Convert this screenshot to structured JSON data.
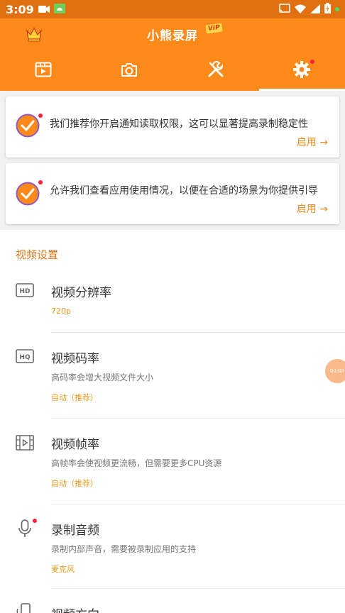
{
  "status_bar": {
    "time": "3:09"
  },
  "header": {
    "title": "小熊录屏",
    "vip": "VIP"
  },
  "tabs": [
    {
      "name": "videos",
      "icon": "film-icon"
    },
    {
      "name": "screenshots",
      "icon": "camera-icon"
    },
    {
      "name": "tools",
      "icon": "tools-icon"
    },
    {
      "name": "settings",
      "icon": "gear-icon",
      "active": true
    }
  ],
  "cards": [
    {
      "text": "我们推荐你开启通知读取权限，这可以显著提高录制稳定性",
      "action": "启用 →"
    },
    {
      "text": "允许我们查看应用使用情况，以便在合适的场景为你提供引导",
      "action": "启用 →"
    }
  ],
  "section": {
    "title": "视频设置"
  },
  "items": [
    {
      "icon": "hd-icon",
      "title": "视频分辨率",
      "desc": "",
      "value": "720p"
    },
    {
      "icon": "hq-icon",
      "title": "视频码率",
      "desc": "高码率会增大视频文件大小",
      "value": "自动（推荐）"
    },
    {
      "icon": "film-frame-icon",
      "title": "视频帧率",
      "desc": "高帧率会使视频更流畅，但需要更多CPU资源",
      "value": "自动（推荐）"
    },
    {
      "icon": "microphone-icon",
      "title": "录制音频",
      "desc": "录制内部声音，需要被录制应用的支持",
      "value": "麦克风"
    },
    {
      "icon": "rotate-screen-icon",
      "title": "视频方向",
      "desc": "",
      "value": ""
    }
  ],
  "float_button": {
    "label": "00:00"
  },
  "colors": {
    "primary": "#fb8a1b",
    "accent": "#e88a1a",
    "badge": "#ff1f3a"
  }
}
